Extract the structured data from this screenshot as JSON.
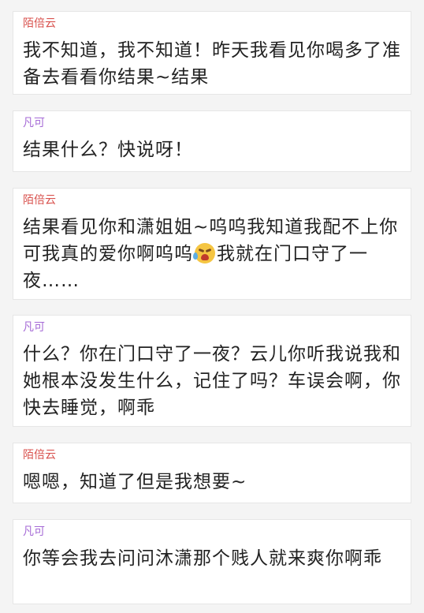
{
  "colors": {
    "speaker_mobeiyun": "#d9534f",
    "speaker_fanke": "#a56ad6"
  },
  "messages": [
    {
      "speaker": "陌倍云",
      "text": "我不知道，我不知道！昨天我看见你喝多了准备去看看你结果~结果"
    },
    {
      "speaker": "凡可",
      "text": "结果什么？快说呀！"
    },
    {
      "speaker": "陌倍云",
      "text_before": "结果看见你和潇姐姐~呜呜我知道我配不上你可我真的爱你啊呜呜",
      "emoji": "crying-face-icon",
      "text_after": "我就在门口守了一夜……"
    },
    {
      "speaker": "凡可",
      "text": "什么？你在门口守了一夜？云儿你听我说我和她根本没发生什么，记住了吗？车误会啊，你快去睡觉，啊乖"
    },
    {
      "speaker": "陌倍云",
      "text": "嗯嗯，知道了但是我想要~"
    },
    {
      "speaker": "凡可",
      "text": "你等会我去问问沐潇那个贱人就来爽你啊乖"
    }
  ]
}
